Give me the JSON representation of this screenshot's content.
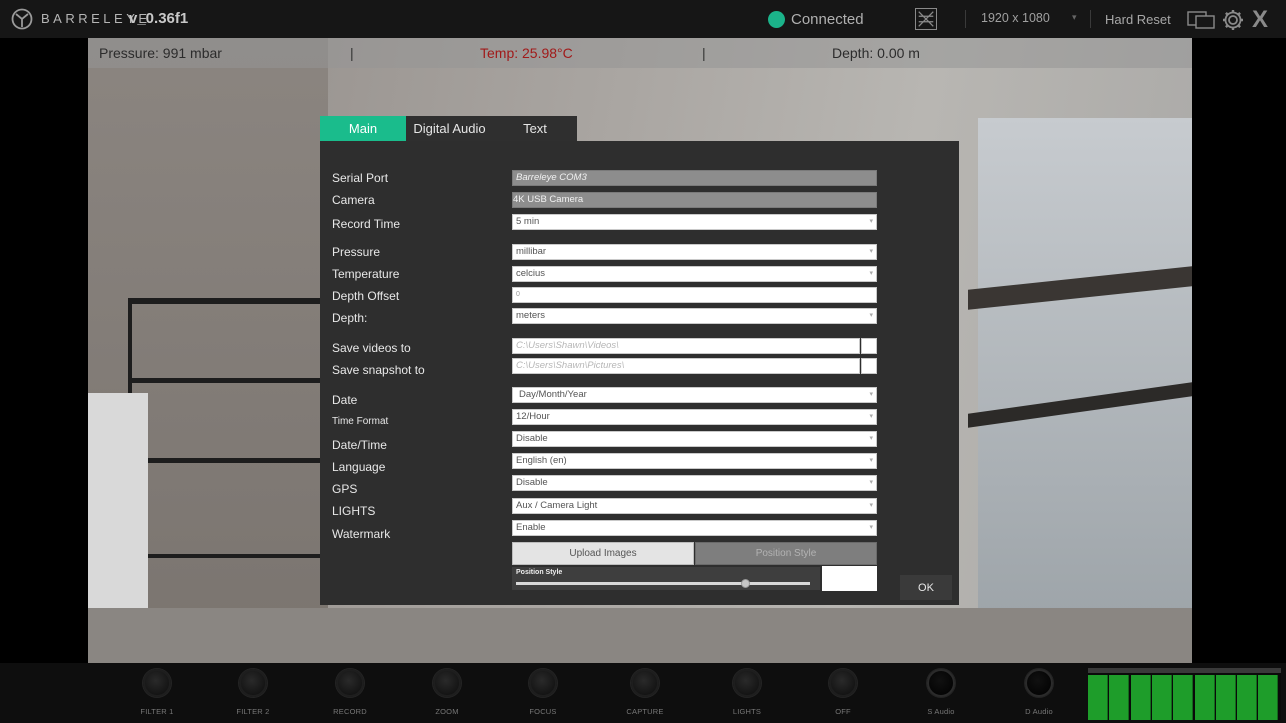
{
  "app": {
    "brand": "BARRELEYE",
    "version": "v_0.36f1",
    "status": "Connected",
    "status_color": "#1bb38a",
    "resolution": "1920 x 1080",
    "hard_reset": "Hard Reset"
  },
  "readouts": {
    "pressure": "Pressure: 991 mbar",
    "temp": "Temp: 25.98°C",
    "depth": "Depth: 0.00 m",
    "separator": "|"
  },
  "dialog": {
    "tabs": [
      "Main",
      "Digital Audio",
      "Text"
    ],
    "active_tab": "Main",
    "accent_color": "#1abc8c",
    "fields": {
      "serial_port": {
        "label": "Serial Port",
        "value": "Barreleye COM3"
      },
      "camera": {
        "label": "Camera",
        "value": "4K USB Camera"
      },
      "record_time": {
        "label": "Record Time",
        "value": "5 min"
      },
      "pressure": {
        "label": "Pressure",
        "value": "millibar"
      },
      "temperature": {
        "label": "Temperature",
        "value": "celcius"
      },
      "depth_offset": {
        "label": "Depth Offset",
        "value": "0"
      },
      "depth": {
        "label": "Depth:",
        "value": "meters"
      },
      "save_videos": {
        "label": "Save videos to",
        "value": "C:\\Users\\Shawn\\Videos\\"
      },
      "save_snapshot": {
        "label": "Save snapshot to",
        "value": "C:\\Users\\Shawn\\Pictures\\"
      },
      "date": {
        "label": "Date",
        "value": "Day/Month/Year"
      },
      "time_format": {
        "label": "Time Format",
        "value": "12/Hour"
      },
      "datetime": {
        "label": "Date/Time",
        "value": "Disable"
      },
      "language": {
        "label": "Language",
        "value": "English (en)"
      },
      "gps": {
        "label": "GPS",
        "value": "Disable"
      },
      "lights": {
        "label": "LIGHTS",
        "value": "Aux / Camera Light"
      },
      "watermark": {
        "label": "Watermark",
        "value": "Enable"
      }
    },
    "upload_images": "Upload Images",
    "position_style_button": "Position Style",
    "position_style_label": "Position Style",
    "position_slider_fraction": 0.78,
    "ok": "OK"
  },
  "controls": [
    "FILTER 1",
    "FILTER 2",
    "RECORD",
    "ZOOM",
    "FOCUS",
    "CAPTURE",
    "LIGHTS",
    "OFF",
    "S Audio",
    "D Audio"
  ]
}
